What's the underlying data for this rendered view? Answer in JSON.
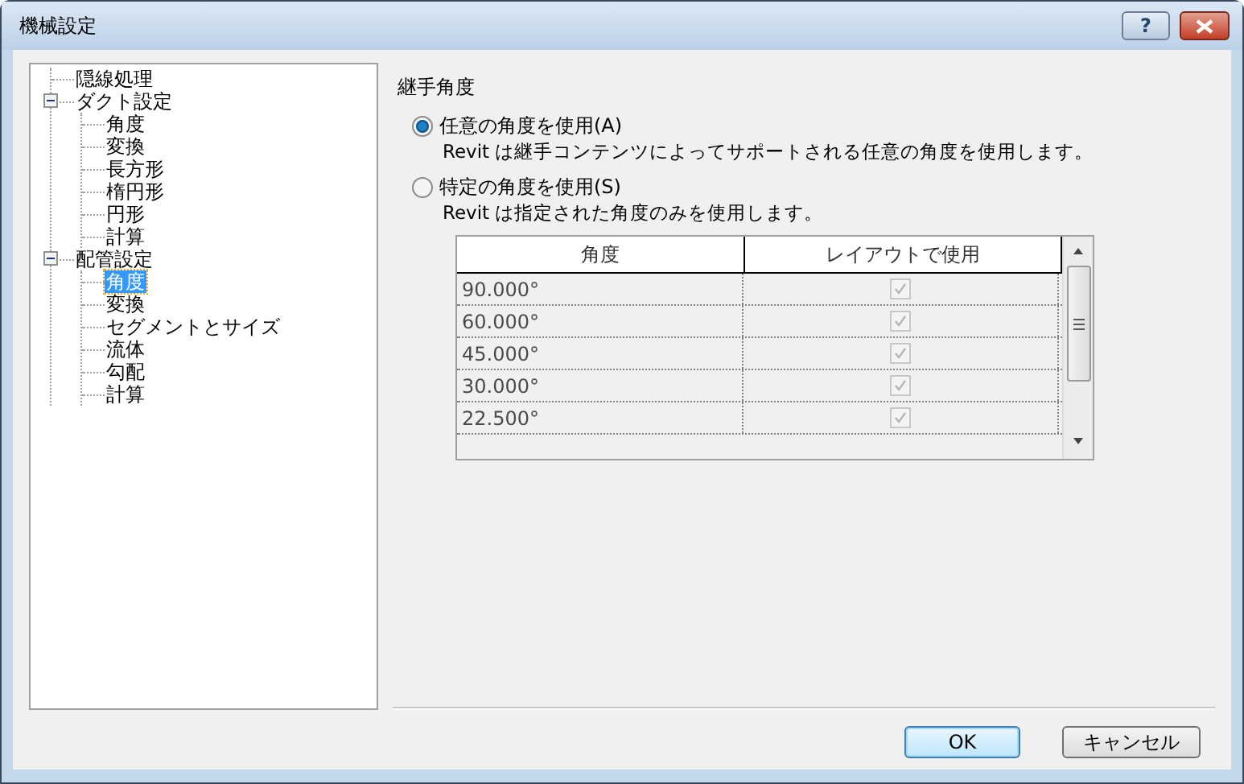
{
  "window": {
    "title": "機械設定",
    "help_button": "?"
  },
  "tree": [
    {
      "label": "隠線処理",
      "selected": false
    },
    {
      "label": "ダクト設定",
      "selected": false,
      "expanded": true,
      "children": [
        {
          "label": "角度",
          "selected": false
        },
        {
          "label": "変換",
          "selected": false
        },
        {
          "label": "長方形",
          "selected": false
        },
        {
          "label": "楕円形",
          "selected": false
        },
        {
          "label": "円形",
          "selected": false
        },
        {
          "label": "計算",
          "selected": false
        }
      ]
    },
    {
      "label": "配管設定",
      "selected": false,
      "expanded": true,
      "children": [
        {
          "label": "角度",
          "selected": true
        },
        {
          "label": "変換",
          "selected": false
        },
        {
          "label": "セグメントとサイズ",
          "selected": false
        },
        {
          "label": "流体",
          "selected": false
        },
        {
          "label": "勾配",
          "selected": false
        },
        {
          "label": "計算",
          "selected": false
        }
      ]
    }
  ],
  "panel": {
    "heading": "継手角度",
    "options": [
      {
        "label": "任意の角度を使用(A)",
        "description": "Revit は継手コンテンツによってサポートされる任意の角度を使用します。",
        "selected": true
      },
      {
        "label": "特定の角度を使用(S)",
        "description": "Revit は指定された角度のみを使用します。",
        "selected": false
      }
    ],
    "table": {
      "columns": [
        "角度",
        "レイアウトで使用"
      ],
      "rows": [
        {
          "angle": "90.000°",
          "checked": true
        },
        {
          "angle": "60.000°",
          "checked": true
        },
        {
          "angle": "45.000°",
          "checked": true
        },
        {
          "angle": "30.000°",
          "checked": true
        },
        {
          "angle": "22.500°",
          "checked": true
        }
      ]
    }
  },
  "buttons": [
    {
      "label": "OK",
      "default": true
    },
    {
      "label": "キャンセル",
      "default": false
    }
  ]
}
